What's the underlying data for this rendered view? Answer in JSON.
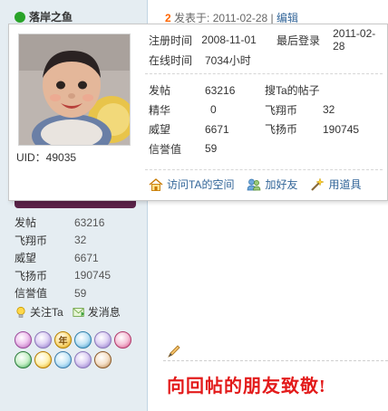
{
  "sidebar": {
    "author_name": "落岸之鱼",
    "stats": [
      {
        "label": "发帖",
        "value": "63216"
      },
      {
        "label": "飞翔币",
        "value": "32"
      },
      {
        "label": "威望",
        "value": "6671"
      },
      {
        "label": "飞扬币",
        "value": "190745"
      },
      {
        "label": "信誉值",
        "value": "59"
      }
    ],
    "actions": {
      "follow": "关注Ta",
      "message": "发消息"
    },
    "medals": [
      "M",
      "M",
      "年",
      "M",
      "M",
      "M",
      "M",
      "M",
      "M",
      "M",
      "M"
    ]
  },
  "post": {
    "floor": "2",
    "posted_label": "发表于: 2011-02-28",
    "separator": "|",
    "edit_label": "编辑",
    "message": "向回帖的朋友致敬!"
  },
  "card": {
    "uid": "UID：49035",
    "register_label": "注册时间",
    "register_value": "2008-11-01",
    "last_login_label": "最后登录",
    "last_login_value": "2011-02-28",
    "online_label": "在线时间",
    "online_value": "7034小时",
    "search_posts": "搜Ta的帖子",
    "stats": {
      "posts_label": "发帖",
      "posts_value": "63216",
      "essence_label": "精华",
      "essence_value": "0",
      "feixiang_label": "飞翔币",
      "feixiang_value": "32",
      "prestige_label": "威望",
      "prestige_value": "6671",
      "feiyang_label": "飞扬币",
      "feiyang_value": "190745",
      "credit_label": "信誉值",
      "credit_value": "59"
    },
    "actions": {
      "visit_space": "访问TA的空间",
      "add_friend": "加好友",
      "use_item": "用道具"
    }
  },
  "colors": {
    "sidebar_bg": "#e5edf2",
    "link": "#336699",
    "message_red": "#e31b1b",
    "floor_orange": "#ff6600"
  }
}
